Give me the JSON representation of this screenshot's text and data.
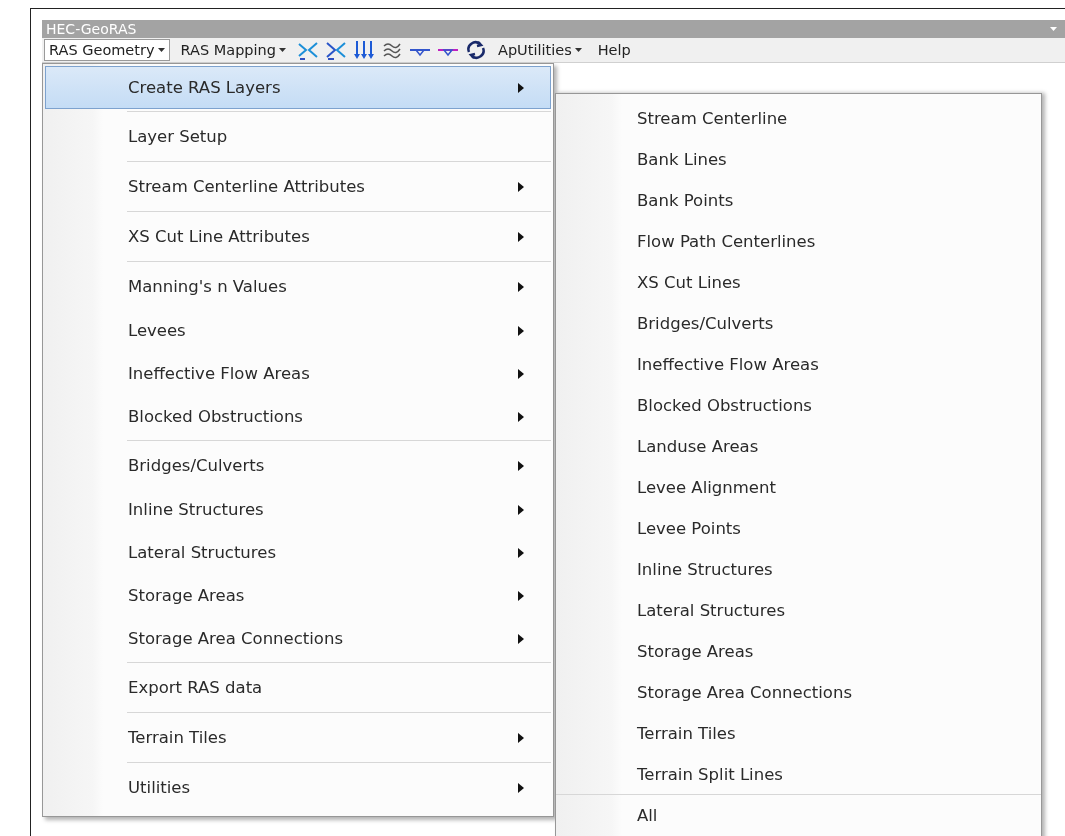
{
  "toolbar": {
    "title": "HEC-GeoRAS",
    "menus": [
      {
        "label": "RAS Geometry",
        "open": true,
        "has_caret": true
      },
      {
        "label": "RAS Mapping",
        "open": false,
        "has_caret": true
      },
      {
        "kind": "icon"
      },
      {
        "kind": "icon"
      },
      {
        "kind": "icon"
      },
      {
        "kind": "icon"
      },
      {
        "kind": "icon"
      },
      {
        "kind": "icon"
      },
      {
        "kind": "icon"
      },
      {
        "label": "ApUtilities",
        "open": false,
        "has_caret": true
      },
      {
        "label": "Help",
        "open": false,
        "has_caret": false
      }
    ]
  },
  "menu": {
    "items": [
      {
        "label": "Create RAS Layers",
        "has_submenu": true,
        "selected": true,
        "divider_above": false
      },
      {
        "label": "Layer Setup",
        "has_submenu": false,
        "selected": false,
        "divider_above": true
      },
      {
        "label": "Stream Centerline Attributes",
        "has_submenu": true,
        "selected": false,
        "divider_above": true
      },
      {
        "label": "XS Cut Line Attributes",
        "has_submenu": true,
        "selected": false,
        "divider_above": true
      },
      {
        "label": "Manning's n Values",
        "has_submenu": true,
        "selected": false,
        "divider_above": true
      },
      {
        "label": "Levees",
        "has_submenu": true,
        "selected": false,
        "divider_above": false
      },
      {
        "label": "Ineffective Flow Areas",
        "has_submenu": true,
        "selected": false,
        "divider_above": false
      },
      {
        "label": "Blocked Obstructions",
        "has_submenu": true,
        "selected": false,
        "divider_above": false
      },
      {
        "label": "Bridges/Culverts",
        "has_submenu": true,
        "selected": false,
        "divider_above": true
      },
      {
        "label": "Inline Structures",
        "has_submenu": true,
        "selected": false,
        "divider_above": false
      },
      {
        "label": "Lateral Structures",
        "has_submenu": true,
        "selected": false,
        "divider_above": false
      },
      {
        "label": "Storage Areas",
        "has_submenu": true,
        "selected": false,
        "divider_above": false
      },
      {
        "label": "Storage Area Connections",
        "has_submenu": true,
        "selected": false,
        "divider_above": false
      },
      {
        "label": "Export RAS data",
        "has_submenu": false,
        "selected": false,
        "divider_above": true
      },
      {
        "label": "Terrain Tiles",
        "has_submenu": true,
        "selected": false,
        "divider_above": true
      },
      {
        "label": "Utilities",
        "has_submenu": true,
        "selected": false,
        "divider_above": true
      }
    ]
  },
  "submenu": {
    "items": [
      {
        "label": "Stream Centerline",
        "divider_above": false
      },
      {
        "label": "Bank Lines",
        "divider_above": false
      },
      {
        "label": "Bank Points",
        "divider_above": false
      },
      {
        "label": "Flow Path Centerlines",
        "divider_above": false
      },
      {
        "label": "XS Cut Lines",
        "divider_above": false
      },
      {
        "label": "Bridges/Culverts",
        "divider_above": false
      },
      {
        "label": "Ineffective Flow Areas",
        "divider_above": false
      },
      {
        "label": "Blocked Obstructions",
        "divider_above": false
      },
      {
        "label": "Landuse Areas",
        "divider_above": false
      },
      {
        "label": "Levee Alignment",
        "divider_above": false
      },
      {
        "label": "Levee Points",
        "divider_above": false
      },
      {
        "label": "Inline Structures",
        "divider_above": false
      },
      {
        "label": "Lateral Structures",
        "divider_above": false
      },
      {
        "label": "Storage Areas",
        "divider_above": false
      },
      {
        "label": "Storage Area Connections",
        "divider_above": false
      },
      {
        "label": "Terrain Tiles",
        "divider_above": false
      },
      {
        "label": "Terrain Split Lines",
        "divider_above": false
      },
      {
        "label": "All",
        "divider_above": true
      }
    ]
  }
}
